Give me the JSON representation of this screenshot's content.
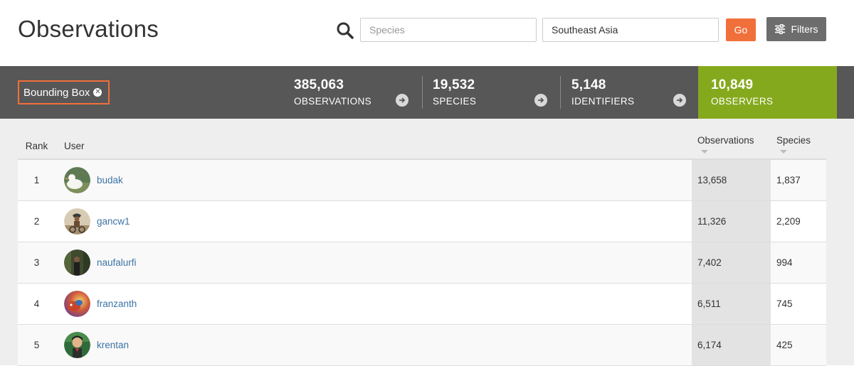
{
  "header": {
    "title": "Observations",
    "species_placeholder": "Species",
    "place_value": "Southeast Asia",
    "go_label": "Go",
    "filters_label": "Filters"
  },
  "filter_chip": {
    "label": "Bounding Box"
  },
  "stats": [
    {
      "count": "385,063",
      "label": "OBSERVATIONS"
    },
    {
      "count": "19,532",
      "label": "SPECIES"
    },
    {
      "count": "5,148",
      "label": "IDENTIFIERS"
    },
    {
      "count": "10,849",
      "label": "OBSERVERS"
    }
  ],
  "colors": {
    "accent_orange": "#f16f3a",
    "active_green": "#85a91d",
    "stats_bg": "#575757",
    "link_blue": "#3d74a6"
  },
  "table": {
    "headers": {
      "rank": "Rank",
      "user": "User",
      "observations": "Observations",
      "species": "Species"
    },
    "rows": [
      {
        "rank": "1",
        "user": "budak",
        "observations": "13,658",
        "species": "1,837"
      },
      {
        "rank": "2",
        "user": "gancw1",
        "observations": "11,326",
        "species": "2,209"
      },
      {
        "rank": "3",
        "user": "naufalurfi",
        "observations": "7,402",
        "species": "994"
      },
      {
        "rank": "4",
        "user": "franzanth",
        "observations": "6,511",
        "species": "745"
      },
      {
        "rank": "5",
        "user": "krentan",
        "observations": "6,174",
        "species": "425"
      }
    ]
  }
}
